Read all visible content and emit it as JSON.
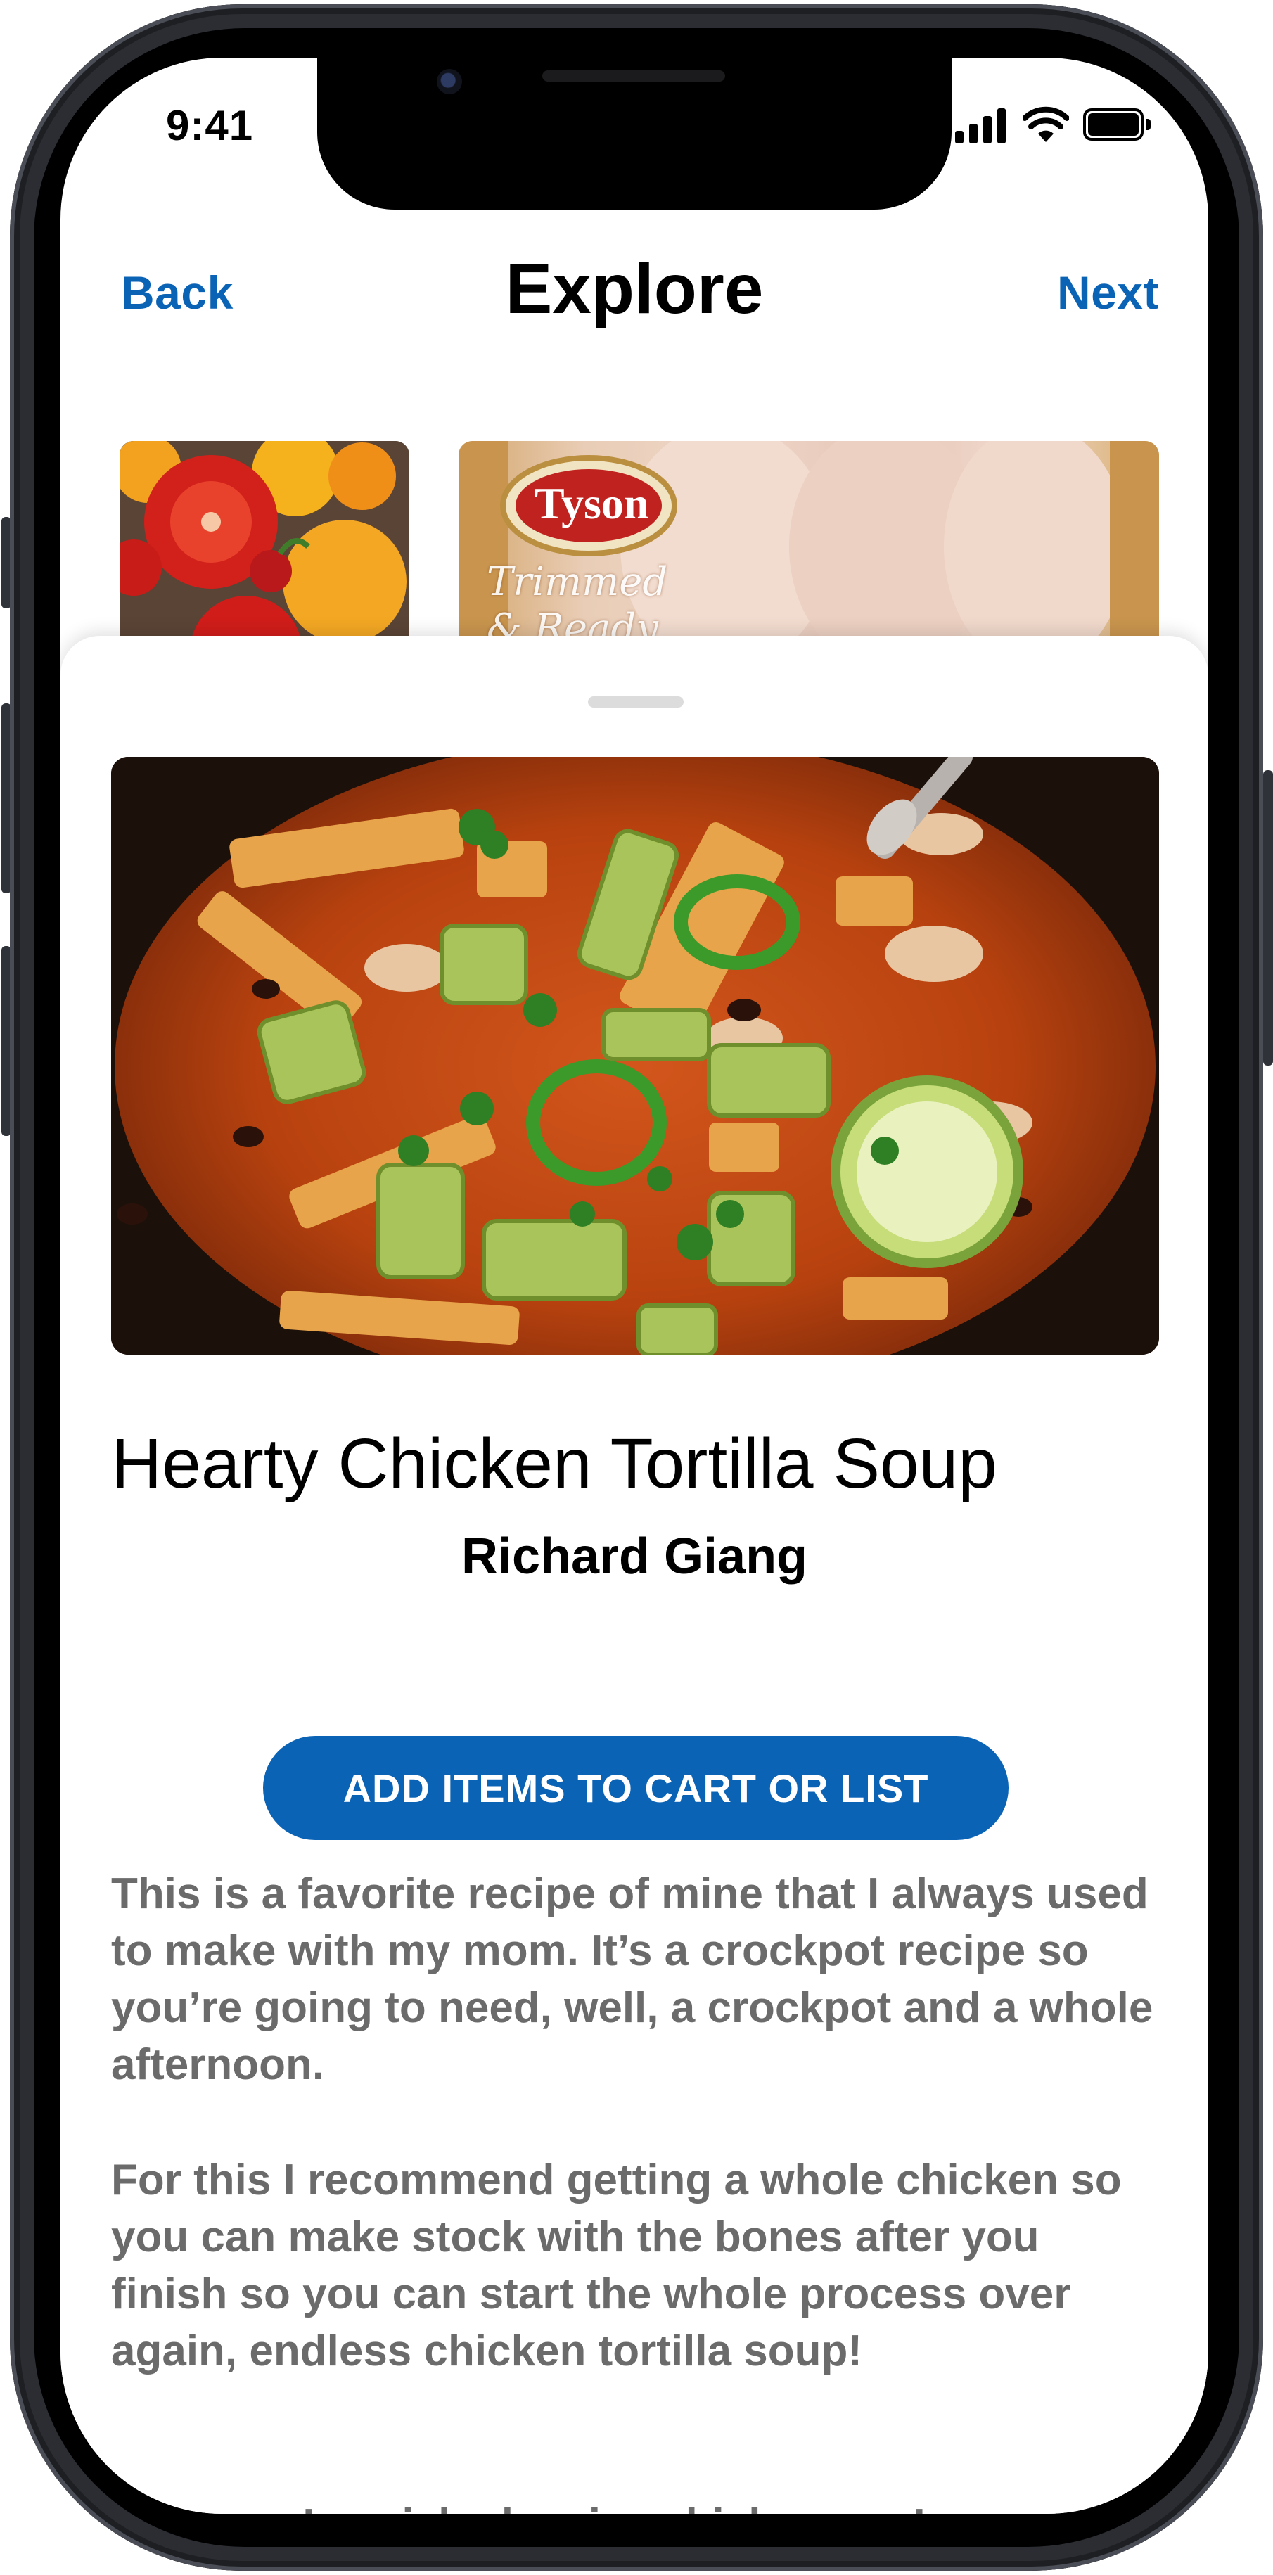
{
  "status_bar": {
    "time": "9:41"
  },
  "nav": {
    "back_label": "Back",
    "title": "Explore",
    "next_label": "Next"
  },
  "explore_thumbnails": [
    {
      "name": "tomatoes"
    },
    {
      "name": "tyson-chicken",
      "brand_text": "Tyson",
      "brand_script": "Trimmed & Ready"
    }
  ],
  "recipe": {
    "title": "Hearty Chicken Tortilla Soup",
    "author": "Richard Giang",
    "cta_label": "ADD ITEMS TO CART OR LIST",
    "paragraphs": [
      "This is a favorite recipe of mine that I always used to make with my mom. It’s a crockpot recipe so you’re going to need, well, a crockpot and a whole afternoon.",
      "For this I recommend getting a whole chicken so you can make stock with the bones after you finish so you can start the whole process over again, endless chicken tortilla soup!",
      "After you’ve picked a nice chicken you’re"
    ]
  },
  "colors": {
    "accent": "#0b63b6",
    "body_text": "#6b6b6b"
  }
}
